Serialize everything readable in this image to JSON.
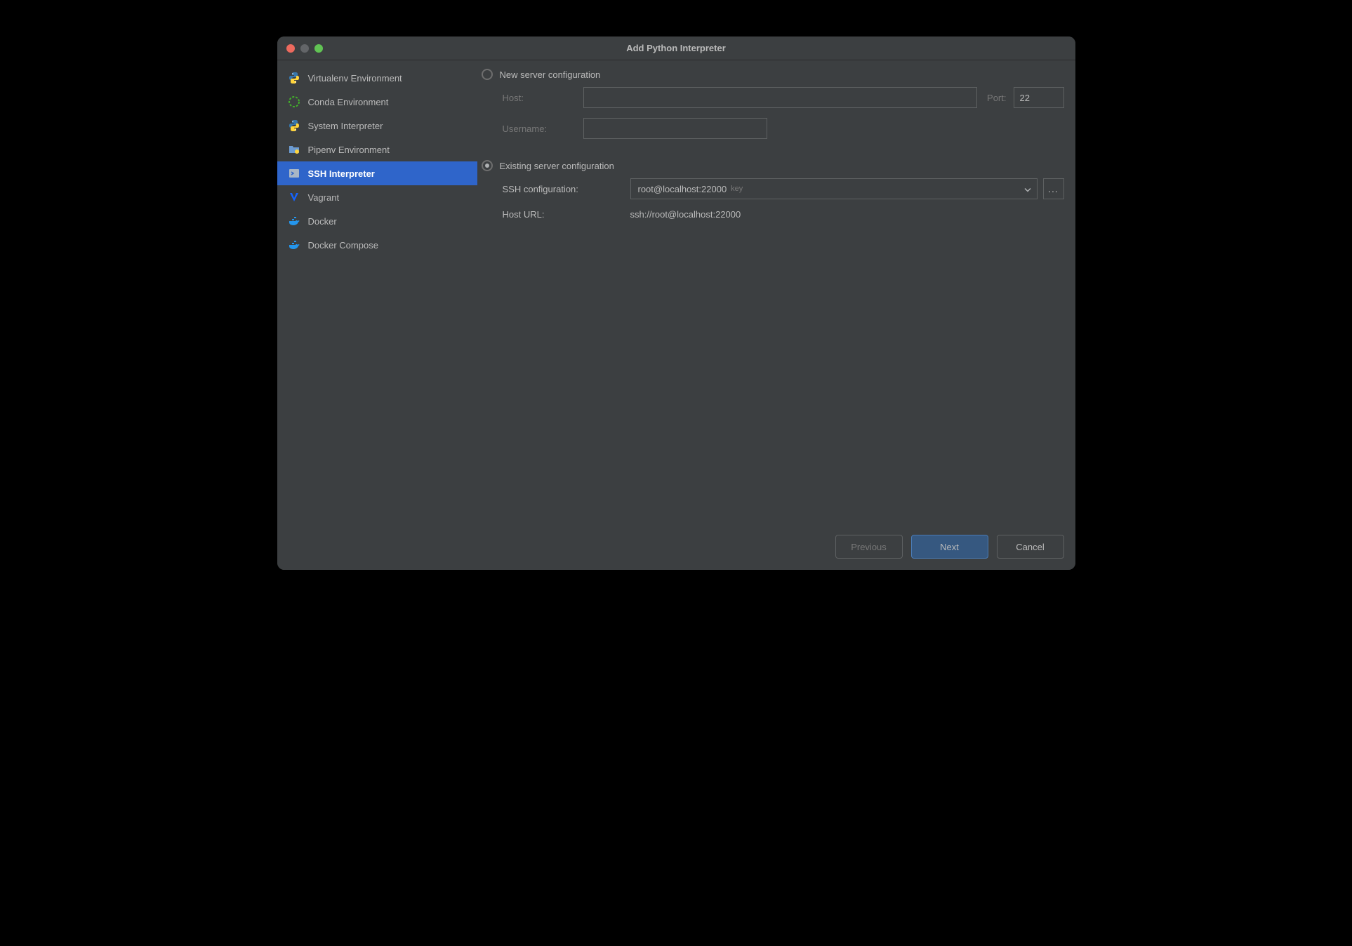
{
  "window": {
    "title": "Add Python Interpreter"
  },
  "sidebar": {
    "items": [
      {
        "label": "Virtualenv Environment"
      },
      {
        "label": "Conda Environment"
      },
      {
        "label": "System Interpreter"
      },
      {
        "label": "Pipenv Environment"
      },
      {
        "label": "SSH Interpreter"
      },
      {
        "label": "Vagrant"
      },
      {
        "label": "Docker"
      },
      {
        "label": "Docker Compose"
      }
    ]
  },
  "form": {
    "new_server_label": "New server configuration",
    "existing_server_label": "Existing server configuration",
    "host_label": "Host:",
    "host_value": "",
    "port_label": "Port:",
    "port_value": "22",
    "username_label": "Username:",
    "username_value": "",
    "ssh_config_label": "SSH configuration:",
    "ssh_config_value": "root@localhost:22000",
    "ssh_config_badge": "key",
    "host_url_label": "Host URL:",
    "host_url_value": "ssh://root@localhost:22000",
    "browse_label": "..."
  },
  "footer": {
    "previous": "Previous",
    "next": "Next",
    "cancel": "Cancel"
  }
}
